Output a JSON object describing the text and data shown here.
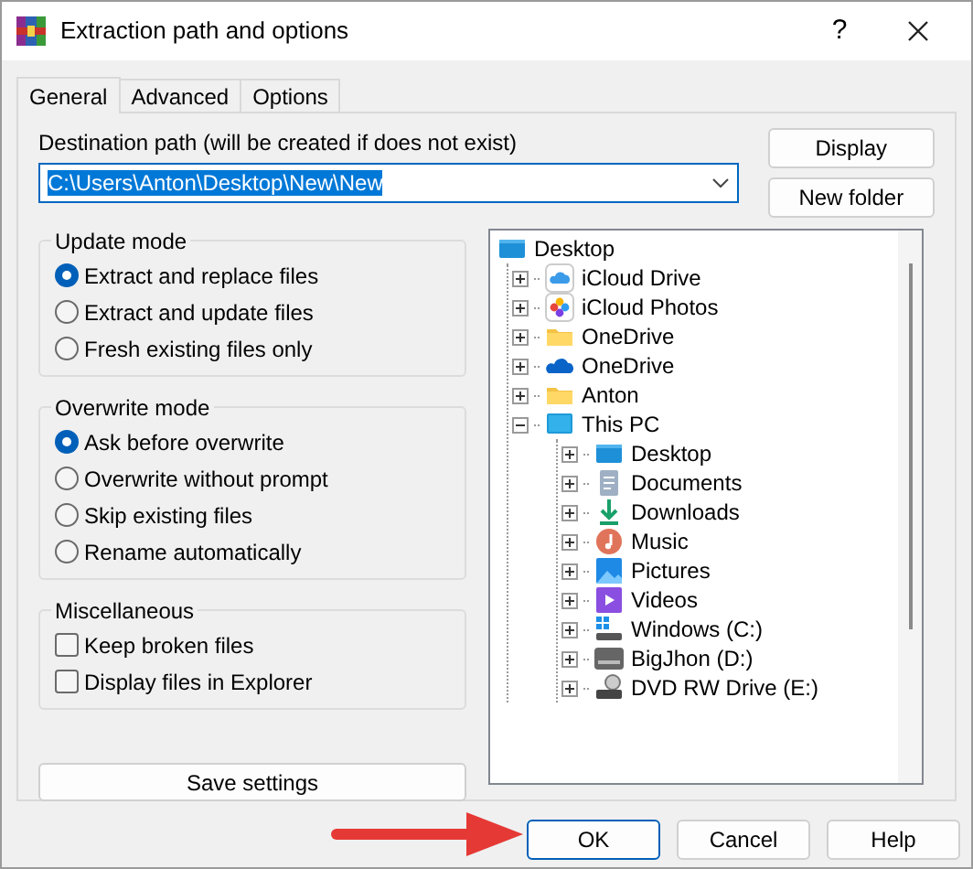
{
  "window": {
    "title": "Extraction path and options",
    "help": "?"
  },
  "tabs": [
    {
      "label": "General",
      "selected": true
    },
    {
      "label": "Advanced",
      "selected": false
    },
    {
      "label": "Options",
      "selected": false
    }
  ],
  "destination": {
    "label": "Destination path (will be created if does not exist)",
    "value": "C:\\Users\\Anton\\Desktop\\New\\New",
    "text_selected": true
  },
  "side_buttons": [
    "Display",
    "New folder"
  ],
  "update_mode": {
    "title": "Update mode",
    "options": [
      {
        "label": "Extract and replace files",
        "selected": true
      },
      {
        "label": "Extract and update files",
        "selected": false
      },
      {
        "label": "Fresh existing files only",
        "selected": false
      }
    ]
  },
  "overwrite_mode": {
    "title": "Overwrite mode",
    "options": [
      {
        "label": "Ask before overwrite",
        "selected": true
      },
      {
        "label": "Overwrite without prompt",
        "selected": false
      },
      {
        "label": "Skip existing files",
        "selected": false
      },
      {
        "label": "Rename automatically",
        "selected": false
      }
    ]
  },
  "miscellaneous": {
    "title": "Miscellaneous",
    "options": [
      {
        "label": "Keep broken files",
        "checked": false
      },
      {
        "label": "Display files in Explorer",
        "checked": false
      }
    ]
  },
  "save_button": "Save settings",
  "folder_tree": [
    {
      "label": "Desktop",
      "kind": "desktop",
      "children": [
        {
          "label": "iCloud Drive",
          "kind": "icloud",
          "expanded": false
        },
        {
          "label": "iCloud Photos",
          "kind": "photos",
          "expanded": false
        },
        {
          "label": "OneDrive",
          "kind": "folder",
          "expanded": false
        },
        {
          "label": "OneDrive",
          "kind": "cloud",
          "expanded": false
        },
        {
          "label": "Anton",
          "kind": "folder",
          "expanded": false
        },
        {
          "label": "This PC",
          "kind": "pc",
          "expanded": true,
          "children": [
            {
              "label": "Desktop",
              "kind": "desktop",
              "expanded": false
            },
            {
              "label": "Documents",
              "kind": "documents",
              "expanded": false
            },
            {
              "label": "Downloads",
              "kind": "downloads",
              "expanded": false
            },
            {
              "label": "Music",
              "kind": "music",
              "expanded": false
            },
            {
              "label": "Pictures",
              "kind": "pictures",
              "expanded": false
            },
            {
              "label": "Videos",
              "kind": "videos",
              "expanded": false
            },
            {
              "label": "Windows (C:)",
              "kind": "system_drive",
              "expanded": false
            },
            {
              "label": "BigJhon (D:)",
              "kind": "drive",
              "expanded": false
            },
            {
              "label": "DVD RW Drive (E:)",
              "kind": "dvd",
              "expanded": false
            }
          ]
        }
      ]
    }
  ],
  "buttons": [
    {
      "label": "OK",
      "default": true
    },
    {
      "label": "Cancel",
      "default": false
    },
    {
      "label": "Help",
      "default": false
    }
  ]
}
